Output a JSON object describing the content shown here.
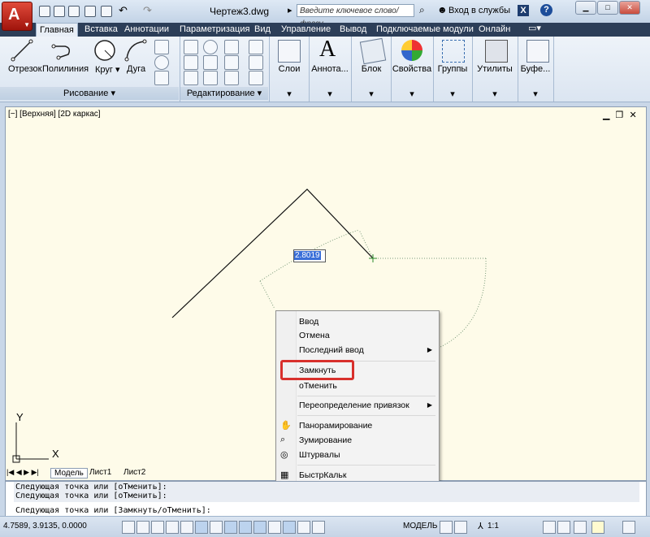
{
  "window": {
    "file_title": "Чертеж3.dwg",
    "search_placeholder": "Введите ключевое слово/фразу",
    "login": "Вход в службы"
  },
  "tabs": [
    "Главная",
    "Вставка",
    "Аннотации",
    "Параметризация",
    "Вид",
    "Управление",
    "Вывод",
    "Подключаемые модули",
    "Онлайн"
  ],
  "ribbon": {
    "draw_tools": [
      "Отрезок",
      "Полилиния",
      "Круг",
      "Дуга"
    ],
    "draw_panel": "Рисование",
    "modify_panel": "Редактирование",
    "big_buttons": [
      "Слои",
      "Аннота...",
      "Блок",
      "Свойства",
      "Группы",
      "Утилиты",
      "Буфе..."
    ]
  },
  "viewport": {
    "label": "[−] [Верхняя] [2D каркас]",
    "dynamic_input": "2.8019",
    "axis_y": "Y",
    "axis_x": "X"
  },
  "context_menu": {
    "items": [
      "Ввод",
      "Отмена",
      "Последний ввод",
      "Замкнуть",
      "оТменить",
      "Переопределение привязок",
      "Панорамирование",
      "Зумирование",
      "Штурвалы",
      "БыстрКальк"
    ]
  },
  "layout_tabs": [
    "Модель",
    "Лист1",
    "Лист2"
  ],
  "command": {
    "history": [
      "Следующая точка или [оТменить]:",
      "Следующая точка или [оТменить]:"
    ],
    "prompt": "Следующая точка или [Замкнуть/оТменить]:"
  },
  "status": {
    "coords": "4.7589, 3.9135, 0.0000",
    "model": "МОДЕЛЬ",
    "scale": "1:1"
  },
  "colors": {
    "highlight": "#d8302c",
    "drawing_bg": "#fefbe9",
    "tab_bar": "#2c3e58"
  }
}
